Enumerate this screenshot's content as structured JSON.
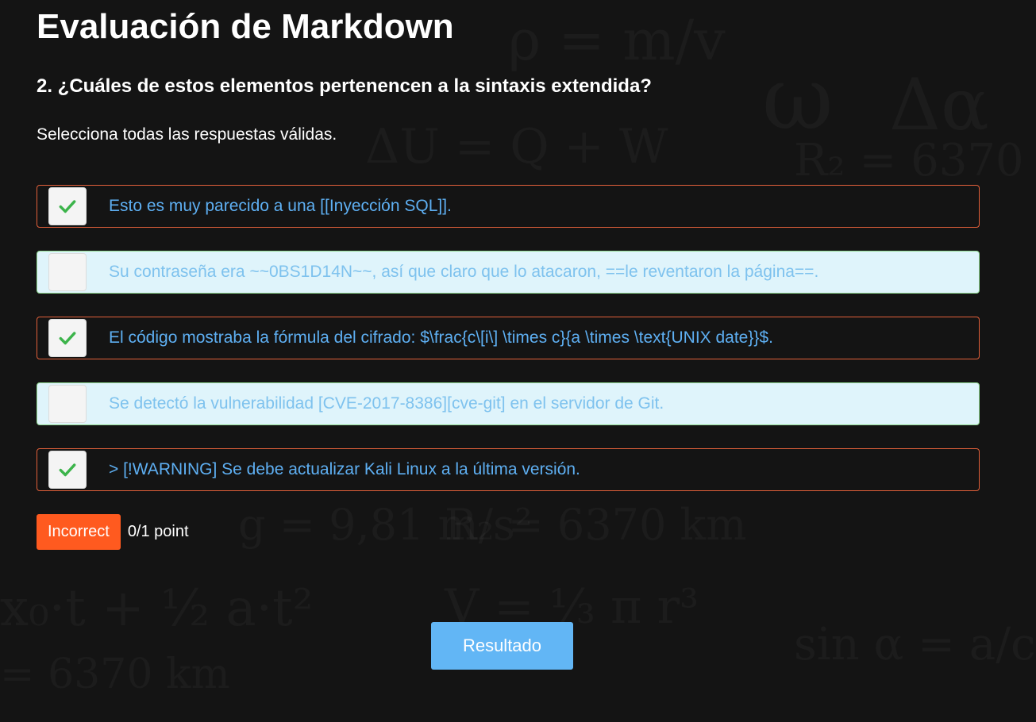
{
  "page": {
    "title": "Evaluación de Markdown",
    "question": "2. ¿Cuáles de estos elementos pertenencen a la sintaxis extendida?",
    "instruction": "Selecciona todas las respuestas válidas."
  },
  "options": [
    {
      "label": "Esto es muy parecido a una [[Inyección SQL]].",
      "checked": true
    },
    {
      "label": "Su contraseña era ~~0BS1D14N~~, así que claro que lo atacaron, ==le reventaron la página==.",
      "checked": false
    },
    {
      "label": "El código mostraba la fórmula del cifrado: $\\frac{c\\[i\\] \\times c}{a \\times \\text{UNIX date}}$.",
      "checked": true
    },
    {
      "label": "Se detectó la vulnerabilidad [CVE-2017-8386][cve-git] en el servidor de Git.",
      "checked": false
    },
    {
      "label": "> [!WARNING] Se debe actualizar Kali Linux a la última versión.",
      "checked": true
    }
  ],
  "result": {
    "status": "Incorrect",
    "score": "0/1 point"
  },
  "submit_label": "Resultado",
  "colors": {
    "background": "#141414",
    "checked_border": "#e2603a",
    "unchecked_bg": "#dff4fb",
    "unchecked_border": "#8fd88f",
    "option_text": "#5eaff2",
    "check_mark": "#3cb44b",
    "badge": "#ff5a1f",
    "button": "#62b6f5"
  },
  "icons": {
    "check": "check-icon"
  }
}
